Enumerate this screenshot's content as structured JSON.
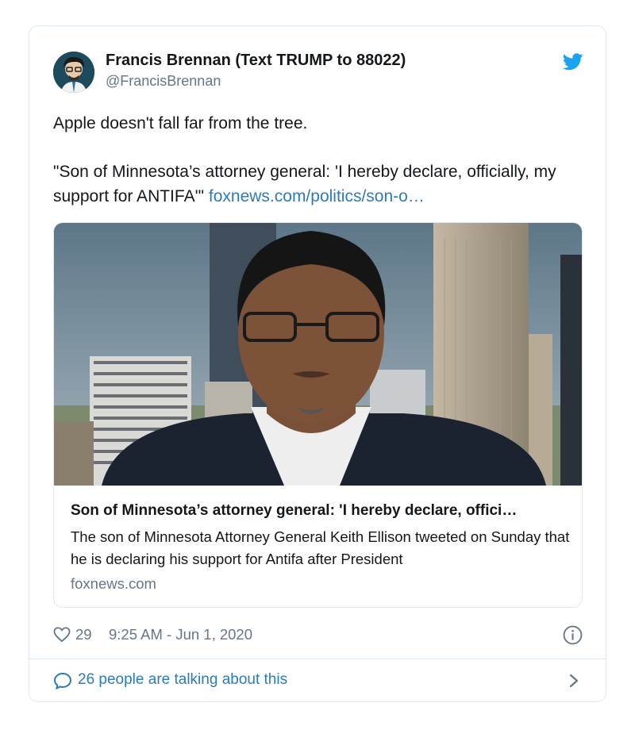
{
  "tweet": {
    "author_name": "Francis Brennan (Text TRUMP to 88022)",
    "author_handle": "@FrancisBrennan",
    "text_line1": "Apple doesn't fall far from the tree.",
    "text_quote": "\"Son of Minnesota’s attorney general: 'I hereby declare, officially, my support for ANTIFA'\"",
    "text_link": "foxnews.com/politics/son-o…"
  },
  "link_card": {
    "title": "Son of Minnesota’s attorney general: 'I hereby declare, offici…",
    "description": "The son of Minnesota Attorney General Keith Ellison tweeted on Sunday that he is declaring his support for Antifa after President",
    "domain": "foxnews.com"
  },
  "footer": {
    "likes": "29",
    "timestamp": "9:25 AM - Jun 1, 2020",
    "talking": "26 people are talking about this"
  },
  "icons": {
    "logo": "twitter-bird-icon",
    "like": "heart-icon",
    "info": "info-icon",
    "reply": "speech-bubble-icon",
    "more": "chevron-right-icon"
  },
  "colors": {
    "twitter_blue": "#1da1f2",
    "link_blue": "#2b7bb9",
    "muted_gray": "#657786",
    "border": "#e1e8ed"
  }
}
